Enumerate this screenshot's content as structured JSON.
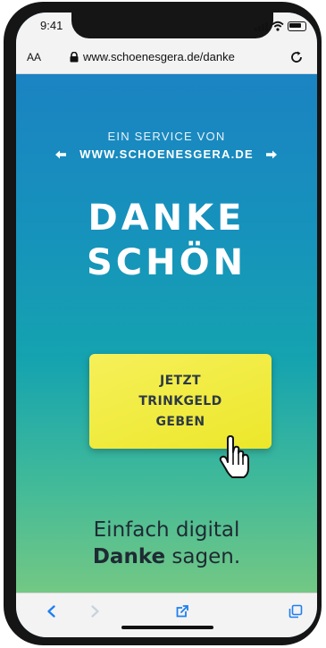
{
  "status_bar": {
    "time": "9:41"
  },
  "browser": {
    "text_size_label": "AA",
    "url": "www.schoenesgera.de/danke"
  },
  "page": {
    "service_line": "EIN SERVICE VON",
    "service_url": "WWW.SCHOENESGERA.DE",
    "headline_line1": "DANKE",
    "headline_line2": "SCHÖN",
    "cta_label": "JETZT\nTRINKGELD\nGEBEN",
    "tagline_line1": "Einfach digital",
    "tagline_bold": "Danke",
    "tagline_rest": " sagen."
  },
  "icons": {
    "status": [
      "signal-icon",
      "wifi-icon",
      "battery-icon"
    ],
    "browser": [
      "lock-icon",
      "reload-icon"
    ],
    "toolbar": [
      "back-icon",
      "forward-icon",
      "share-icon",
      "tabs-icon"
    ]
  },
  "colors": {
    "gradient_top": "#1b83c2",
    "gradient_bottom": "#73c884",
    "cta_yellow": "#ece72a",
    "toolbar_blue": "#1f7ff0"
  }
}
